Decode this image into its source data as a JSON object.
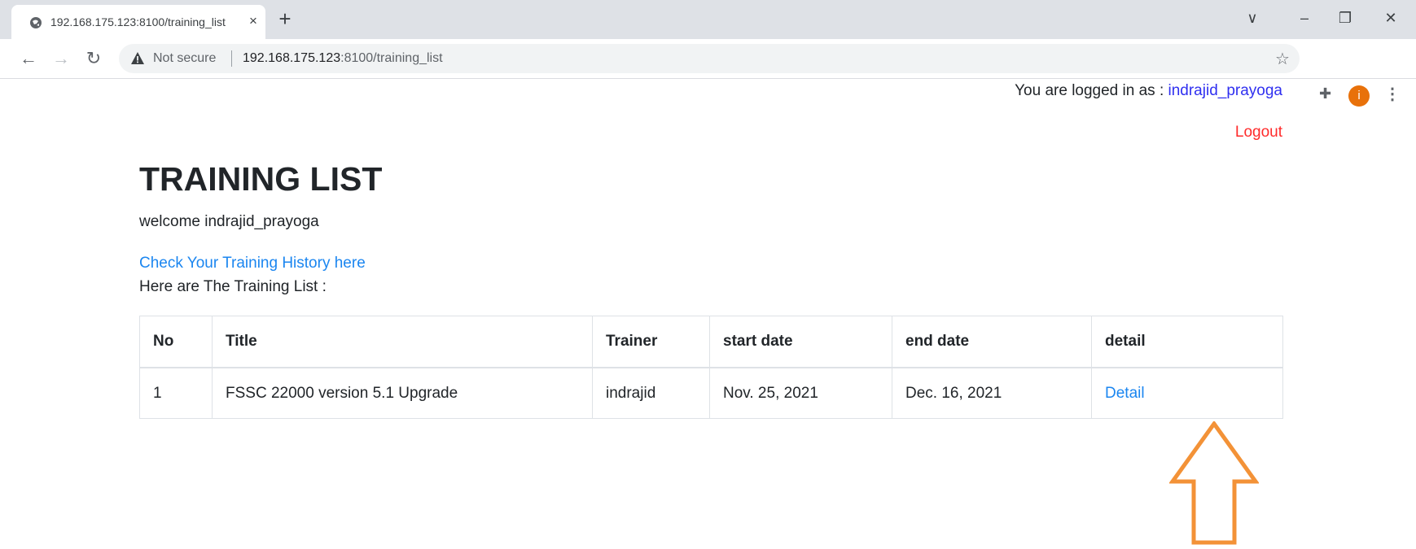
{
  "browser": {
    "tab_title": "192.168.175.123:8100/training_list",
    "tab_close": "×",
    "new_tab": "+",
    "controls": {
      "menu_down": "∨",
      "minimize": "–",
      "restore": "❐",
      "close": "✕"
    },
    "security_label": "Not secure",
    "url_host": "192.168.175.123",
    "url_rest": ":8100/training_list",
    "profile_initial": "i"
  },
  "header": {
    "logged_in_prefix": "You are logged in as : ",
    "username": "indrajid_prayoga",
    "logout": "Logout"
  },
  "main": {
    "title": "TRAINING LIST",
    "welcome": "welcome indrajid_prayoga",
    "history_link": "Check Your Training History here",
    "list_intro": "Here are The Training List :"
  },
  "table": {
    "headers": [
      "No",
      "Title",
      "Trainer",
      "start date",
      "end date",
      "detail"
    ],
    "rows": [
      {
        "no": "1",
        "title": "FSSC 22000 version 5.1 Upgrade",
        "trainer": "indrajid",
        "start": "Nov. 25, 2021",
        "end": "Dec. 16, 2021",
        "detail": "Detail"
      }
    ]
  },
  "annotation": {
    "arrow_color": "#f39237",
    "arrow_icon": "up-arrow-outline-icon"
  },
  "colors": {
    "link": "#1b86f0",
    "username": "#2f2ff0",
    "logout": "#ff2b2b"
  }
}
